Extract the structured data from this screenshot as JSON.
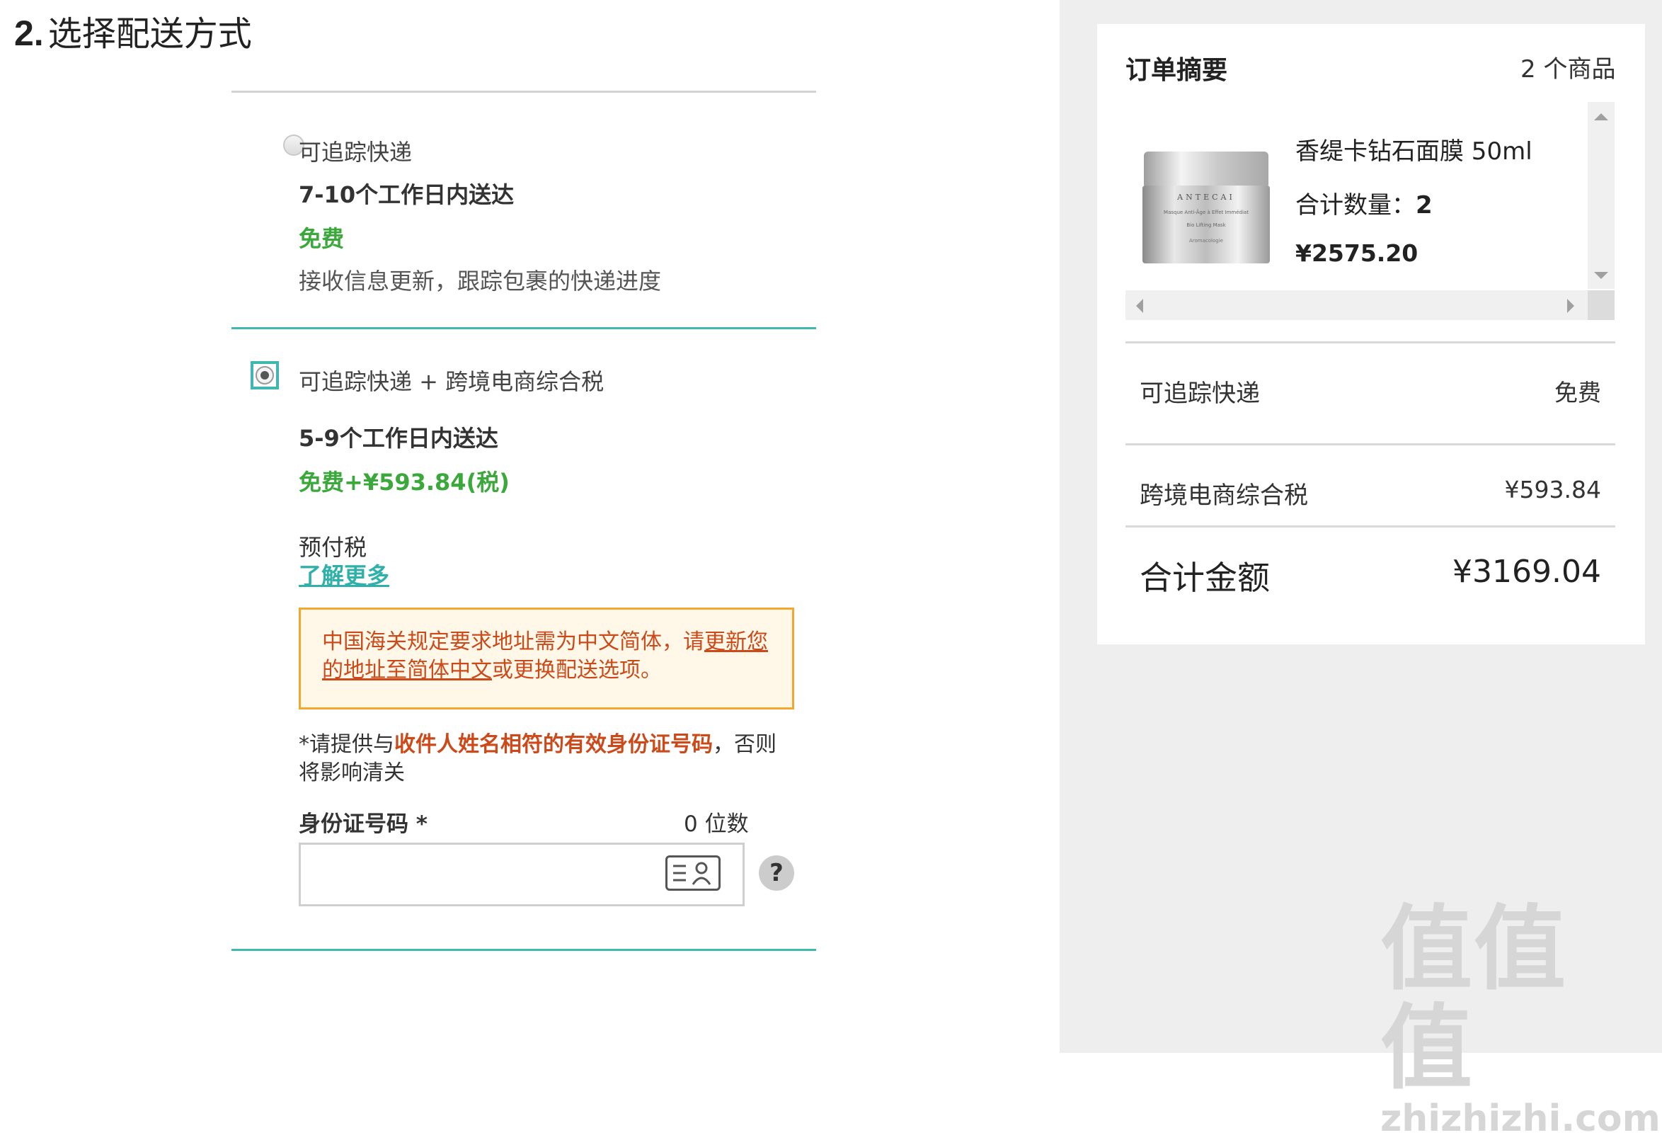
{
  "section": {
    "step_number": "2.",
    "title": "选择配送方式"
  },
  "options": [
    {
      "label": "可追踪快递",
      "delivery_time": "7-10个工作日内送达",
      "price": "免费",
      "description": "接收信息更新，跟踪包裹的快递进度",
      "selected": false
    },
    {
      "label": "可追踪快递 + 跨境电商综合税",
      "delivery_time": "5-9个工作日内送达",
      "price": "免费+¥593.84(税)",
      "prepay_label": "预付税",
      "learn_more": "了解更多",
      "selected": true
    }
  ],
  "warning": {
    "text_before": "中国海关规定要求地址需为中文简体，请",
    "link_text": "更新您的地址至简体中文",
    "text_after": "或更换配送选项。"
  },
  "id_section": {
    "note_before": "*请提供与",
    "note_emphasis": "收件人姓名相符的有效身份证号码",
    "note_after": "，否则将影响清关",
    "field_label": "身份证号码 *",
    "digit_count": "0 位数",
    "input_value": "",
    "help_label": "?"
  },
  "summary": {
    "title": "订单摘要",
    "item_count": "2 个商品",
    "product": {
      "name": "香缇卡钻石面膜 50ml",
      "qty_label": "合计数量：",
      "qty": "2",
      "price": "¥2575.20",
      "jar_text_1": "ANTECAI",
      "jar_text_2": "Masque Anti-Âge à Effet Immédiat",
      "jar_text_3": "Bio Lifting Mask",
      "jar_text_4": "Aromacologie"
    },
    "shipping_label": "可追踪快递",
    "shipping_value": "免费",
    "tax_label": "跨境电商综合税",
    "tax_value": "¥593.84",
    "total_label": "合计金额",
    "total_value": "¥3169.04"
  },
  "watermark": {
    "cn": "值值值",
    "en": "zhizhizhi.com"
  },
  "colors": {
    "accent": "#40b8b0",
    "price_green": "#3aa83a",
    "warning_red": "#cc4a1a",
    "warning_border": "#f0a830",
    "warning_bg": "#fff8e8"
  }
}
